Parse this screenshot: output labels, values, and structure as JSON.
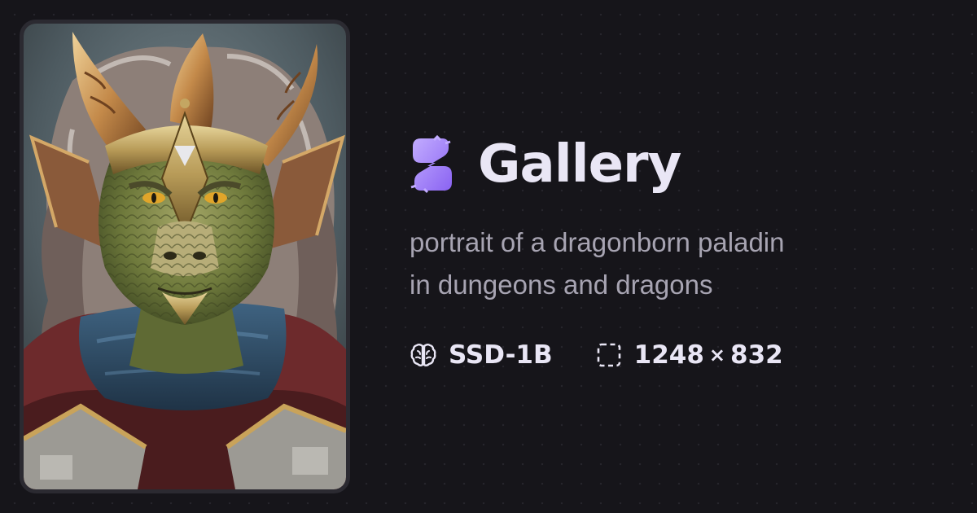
{
  "image": {
    "subject": "dragonborn-paladin-portrait"
  },
  "header": {
    "logo_icon": "sparkle-s-logo-icon",
    "title": "Gallery"
  },
  "prompt": {
    "line1": "portrait of a dragonborn paladin",
    "line2": "in dungeons and dragons"
  },
  "meta": {
    "model_icon": "brain-icon",
    "model": "SSD-1B",
    "size_icon": "dashed-frame-icon",
    "width": "1248",
    "times": "×",
    "height": "832"
  },
  "colors": {
    "background": "#16151a",
    "accent": "#a58bff",
    "title": "#e9e6f5",
    "muted": "#a7a4b2"
  }
}
